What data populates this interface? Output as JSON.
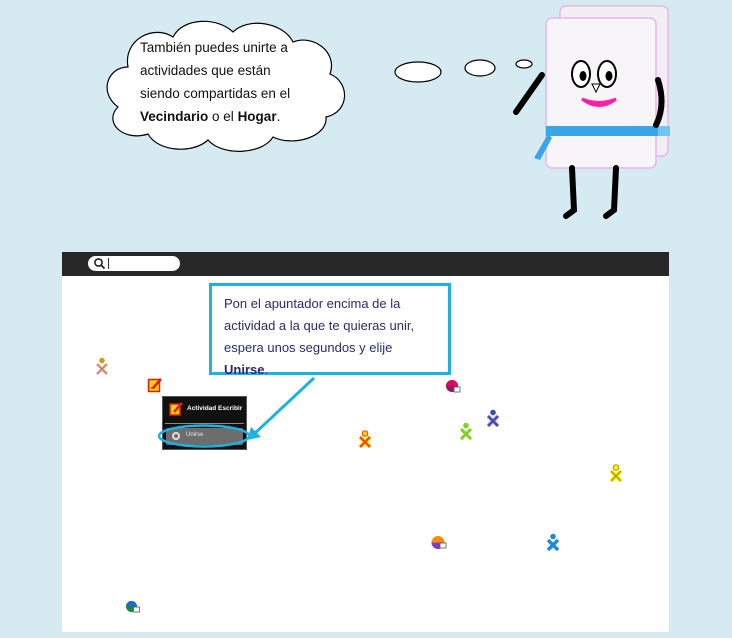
{
  "thought_cloud": {
    "line1": "También puedes unirte a",
    "line2": "actividades que están",
    "line3": "siendo compartidas  en el",
    "bold1": "Vecindario",
    "mid": " o el ",
    "bold2": "Hogar",
    "end": "."
  },
  "callout": {
    "line1": "Pon el apuntador encima de la",
    "line2": "actividad a la que te quieras unir,",
    "line3": "espera unos segundos y  elije",
    "bold": "Unirse",
    "end": "."
  },
  "palette": {
    "title": "Actividad Escribir",
    "join_label": "Unirse"
  },
  "colors": {
    "background": "#d6ebf1",
    "toolbar": "#282828",
    "callout_border": "#1fb2e0",
    "callout_text": "#2b2b6e"
  },
  "icons": {
    "search": "search-icon",
    "join": "join-icon",
    "write_activity": "write-activity-icon",
    "xo_buddy": "xo-buddy-icon",
    "shared_activity": "shared-activity-icon"
  }
}
